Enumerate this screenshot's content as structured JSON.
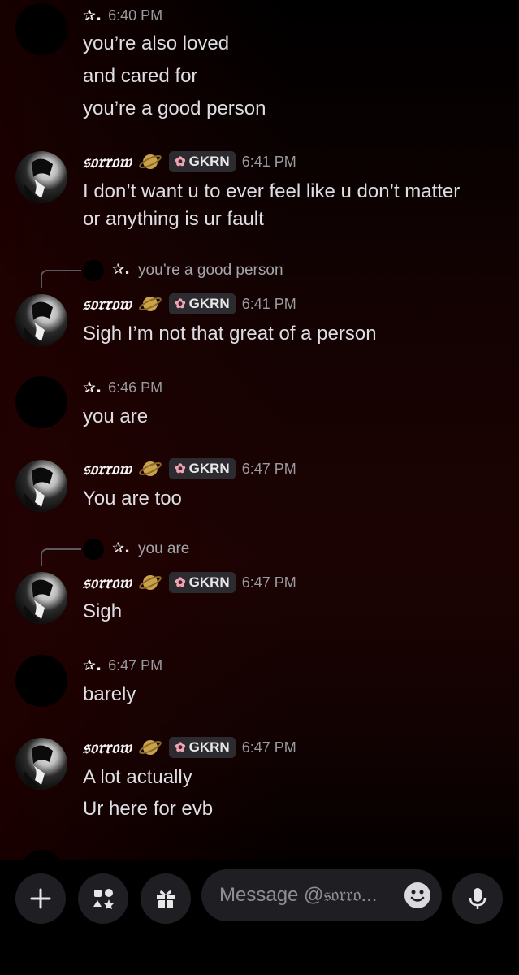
{
  "messages": [
    {
      "author": "✰.",
      "time": "6:40 PM",
      "lines": [
        "you’re also loved",
        "and cared for",
        "you’re a good person"
      ]
    },
    {
      "author": "𝔰𝔬𝔯𝔯𝔬𝔴",
      "tag": "GKRN",
      "time": "6:41 PM",
      "lines": [
        "I don’t want u to ever feel like u don’t matter",
        "or anything is ur fault"
      ]
    },
    {
      "reply": {
        "author": "✰.",
        "text": "you’re a good person"
      },
      "author": "𝔰𝔬𝔯𝔯𝔬𝔴",
      "tag": "GKRN",
      "time": "6:41 PM",
      "lines": [
        "Sigh I’m not that great of a person"
      ]
    },
    {
      "author": "✰.",
      "time": "6:46 PM",
      "lines": [
        "you are"
      ]
    },
    {
      "author": "𝔰𝔬𝔯𝔯𝔬𝔴",
      "tag": "GKRN",
      "time": "6:47 PM",
      "lines": [
        "You are too"
      ]
    },
    {
      "reply": {
        "author": "✰.",
        "text": "you are"
      },
      "author": "𝔰𝔬𝔯𝔯𝔬𝔴",
      "tag": "GKRN",
      "time": "6:47 PM",
      "lines": [
        "Sigh"
      ]
    },
    {
      "author": "✰.",
      "time": "6:47 PM",
      "lines": [
        "barely"
      ]
    },
    {
      "author": "𝔰𝔬𝔯𝔯𝔬𝔴",
      "tag": "GKRN",
      "time": "6:47 PM",
      "lines": [
        "A lot actually",
        "Ur here for evb"
      ]
    }
  ],
  "composer": {
    "placeholder": "Message @𝔰𝔬𝔯𝔯𝔬...",
    "buttons": [
      "plus-icon",
      "apps-icon",
      "gift-icon",
      "microphone-icon"
    ]
  },
  "icons": {
    "tag_icon": "flower-icon",
    "badge_icon": "planet-icon"
  },
  "colors": {
    "tag_flower": "#f3a2b3",
    "timestamp": "#9a9ba1",
    "background_tint": "#1c0303"
  }
}
